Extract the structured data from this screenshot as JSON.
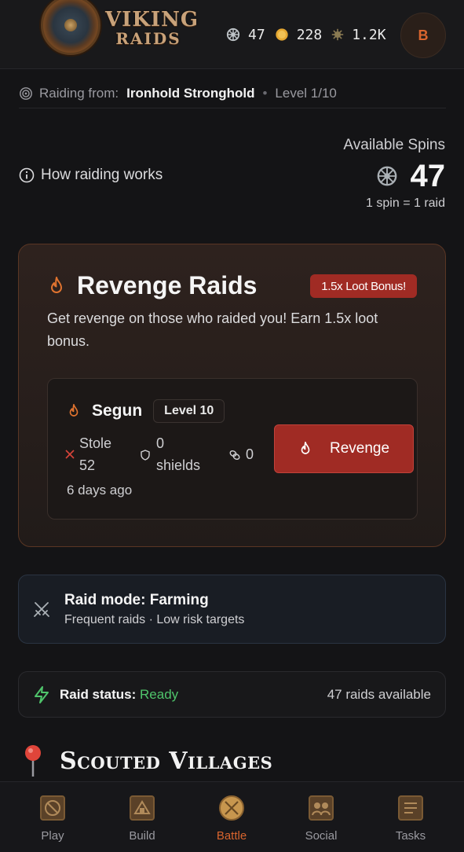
{
  "app": {
    "logo_line1": "VIKING",
    "logo_line2": "RAIDS",
    "logo_icon": "round-shield-icon"
  },
  "header": {
    "stats": [
      {
        "icon": "spin-wheel-icon",
        "value": "47"
      },
      {
        "icon": "gold-coin-icon",
        "value": "228"
      },
      {
        "icon": "gem-icon",
        "value": "1.2K"
      }
    ],
    "avatar_initial": "B"
  },
  "raid_from": {
    "label": "Raiding from:",
    "place": "Ironhold Stronghold",
    "level": "Level 1/10"
  },
  "help": {
    "label": "How raiding works"
  },
  "spins": {
    "label": "Available Spins",
    "count": "47",
    "rate": "1 spin = 1 raid"
  },
  "revenge": {
    "title": "Revenge Raids",
    "badge": "1.5x Loot Bonus!",
    "description": "Get revenge on those who raided you! Earn 1.5x loot bonus.",
    "targets": [
      {
        "name": "Segun",
        "level": "Level 10",
        "stole_label": "Stole",
        "stole_value": "52",
        "shields_value": "0",
        "shields_label": "shields",
        "links_value": "0",
        "time": "6 days ago",
        "button": "Revenge"
      }
    ]
  },
  "mode": {
    "title": "Raid mode: Farming",
    "subtitle": "Frequent raids · Low risk targets"
  },
  "status": {
    "label": "Raid status:",
    "value": "Ready",
    "available": "47 raids available"
  },
  "scouted": {
    "title": "Scouted Villages"
  },
  "nav": [
    {
      "label": "Play",
      "icon": "play-icon",
      "active": false
    },
    {
      "label": "Build",
      "icon": "build-icon",
      "active": false
    },
    {
      "label": "Battle",
      "icon": "battle-icon",
      "active": true
    },
    {
      "label": "Social",
      "icon": "social-icon",
      "active": false
    },
    {
      "label": "Tasks",
      "icon": "tasks-icon",
      "active": false
    }
  ],
  "colors": {
    "accent": "#d9652e",
    "danger": "#a02b24",
    "success": "#4fc46b",
    "background": "#141416"
  }
}
